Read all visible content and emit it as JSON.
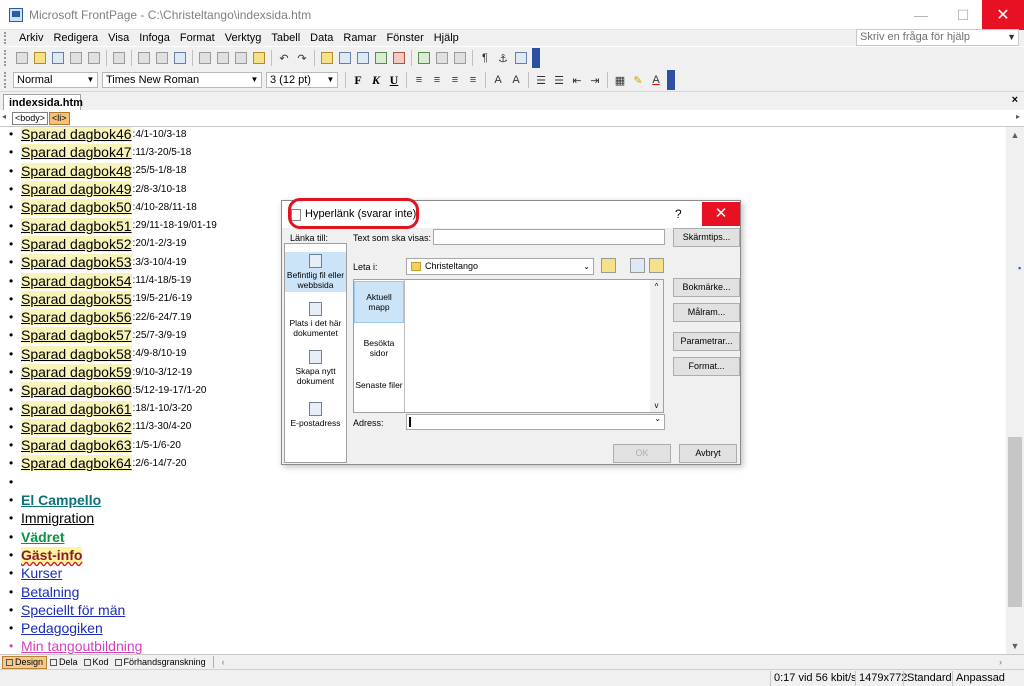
{
  "window": {
    "title": "Microsoft FrontPage - C:\\Christeltango\\indexsida.htm",
    "min_icon": "—",
    "max_icon": "☐",
    "close_icon": "✕"
  },
  "menu": {
    "items": [
      "Arkiv",
      "Redigera",
      "Visa",
      "Infoga",
      "Format",
      "Verktyg",
      "Tabell",
      "Data",
      "Ramar",
      "Fönster",
      "Hjälp"
    ],
    "help_placeholder": "Skriv en fråga för hjälp"
  },
  "format_toolbar": {
    "style": "Normal",
    "font": "Times New Roman",
    "size": "3  (12 pt)",
    "bold": "F",
    "italic": "K",
    "underline": "U"
  },
  "doc": {
    "tab": "indexsida.htm",
    "close": "×",
    "tags": [
      "<body>",
      "<li>"
    ]
  },
  "content": {
    "saved_items": [
      {
        "label": "Sparad dagbok46",
        "dates": ":4/1-10/3-18"
      },
      {
        "label": "Sparad dagbok47",
        "dates": ":11/3-20/5-18"
      },
      {
        "label": "Sparad dagbok48",
        "dates": ":25/5-1/8-18"
      },
      {
        "label": "Sparad dagbok49",
        "dates": ":2/8-3/10-18"
      },
      {
        "label": "Sparad dagbok50",
        "dates": ":4/10-28/11-18"
      },
      {
        "label": "Sparad dagbok51",
        "dates": ":29/11-18-19/01-19"
      },
      {
        "label": "Sparad dagbok52",
        "dates": ":20/1-2/3-19"
      },
      {
        "label": "Sparad dagbok53",
        "dates": ":3/3-10/4-19"
      },
      {
        "label": "Sparad dagbok54",
        "dates": ":11/4-18/5-19"
      },
      {
        "label": "Sparad dagbok55",
        "dates": ":19/5-21/6-19"
      },
      {
        "label": "Sparad dagbok56",
        "dates": ":22/6-24/7.19"
      },
      {
        "label": "Sparad dagbok57",
        "dates": ":25/7-3/9-19"
      },
      {
        "label": "Sparad dagbok58",
        "dates": ":4/9-8/10-19"
      },
      {
        "label": "Sparad dagbok59",
        "dates": ":9/10-3/12-19"
      },
      {
        "label": "Sparad dagbok60",
        "dates": ":5/12-19-17/1-20"
      },
      {
        "label": "Sparad dagbok61",
        "dates": ":18/1-10/3-20"
      },
      {
        "label": "Sparad dagbok62",
        "dates": ":11/3-30/4-20"
      },
      {
        "label": "Sparad dagbok63",
        "dates": ":1/5-1/6-20"
      },
      {
        "label": "Sparad dagbok64",
        "dates": ":2/6-14/7-20"
      }
    ],
    "links": [
      {
        "label": "El Campello",
        "style": "teal"
      },
      {
        "label": "Immigration",
        "style": "black"
      },
      {
        "label": "Vädret",
        "style": "green"
      },
      {
        "label": "Gäst-info",
        "style": "maroon"
      },
      {
        "label": "Kurser",
        "style": "blue"
      },
      {
        "label": "Betalning",
        "style": "blue"
      },
      {
        "label": "Speciellt för män",
        "style": "blue"
      },
      {
        "label": "Pedagogiken",
        "style": "blue"
      },
      {
        "label": "Min tangoutbildning",
        "style": "pink"
      }
    ]
  },
  "view_tabs": [
    "Design",
    "Dela",
    "Kod",
    "Förhandsgranskning"
  ],
  "status": {
    "speed": "0:17 vid 56 kbit/s",
    "size": "1479x772",
    "mode": "Standard",
    "custom": "Anpassad"
  },
  "dialog": {
    "title": "Hyperlänk (svarar inte)",
    "help": "?",
    "close": "✕",
    "link_to_label": "Länka till:",
    "text_label": "Text som ska visas:",
    "text_value": "",
    "screentip_button": "Skärmtips...",
    "look_in_label": "Leta i:",
    "look_in_value": "Christeltango",
    "link_targets": [
      {
        "label": "Befintlig fil eller webbsida"
      },
      {
        "label": "Plats i det här dokumentet"
      },
      {
        "label": "Skapa nytt dokument"
      },
      {
        "label": "E-postadress"
      }
    ],
    "places": [
      "Aktuell mapp",
      "Besökta sidor",
      "Senaste filer"
    ],
    "bookmark_button": "Bokmärke...",
    "target_frame_button": "Målram...",
    "parameters_button": "Parametrar...",
    "style_button": "Format...",
    "address_label": "Adress:",
    "address_value": "",
    "ok_button": "OK",
    "cancel_button": "Avbryt"
  },
  "colors": {
    "highlight_circle": "#e0141e",
    "close_red": "#e81123",
    "selection_blue": "#cce4f7"
  }
}
